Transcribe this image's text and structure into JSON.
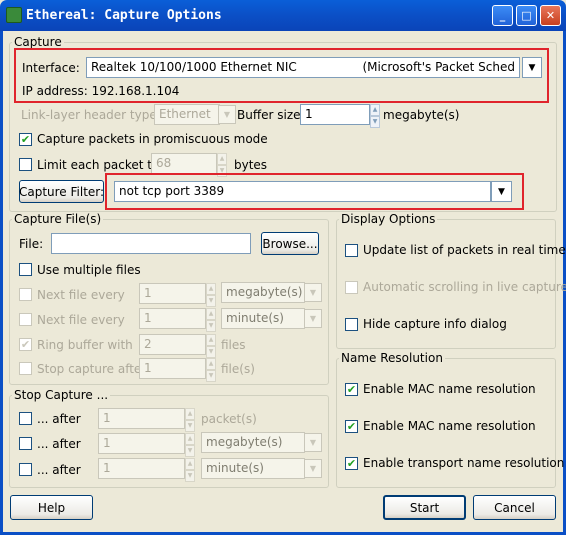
{
  "window": {
    "title": "Ethereal: Capture Options",
    "minimize": "_",
    "maximize": "□",
    "close": "✕"
  },
  "capture": {
    "legend": "Capture",
    "interface_label": "Interface:",
    "interface_value": "Realtek 10/100/1000 Ethernet NIC",
    "interface_suffix": "(Microsoft's Packet Sched",
    "ip_address": "IP address: 192.168.1.104",
    "link_layer_label": "Link-layer header type:",
    "link_layer_value": "Ethernet",
    "buffer_label": "Buffer size:",
    "buffer_value": "1",
    "buffer_unit": "megabyte(s)",
    "promiscuous_label": "Capture packets in promiscuous mode",
    "limit_label": "Limit each packet to",
    "limit_value": "68",
    "limit_unit": "bytes",
    "filter_button": "Capture Filter:",
    "filter_value": "not tcp port 3389"
  },
  "capture_files": {
    "legend": "Capture File(s)",
    "file_label": "File:",
    "file_value": "",
    "browse": "Browse...",
    "multiple_files": "Use multiple files",
    "next_every_1": "Next file every",
    "next_every_1_value": "1",
    "next_every_1_unit": "megabyte(s)",
    "next_every_2": "Next file every",
    "next_every_2_value": "1",
    "next_every_2_unit": "minute(s)",
    "ring_buffer": "Ring buffer with",
    "ring_buffer_value": "2",
    "ring_buffer_unit": "files",
    "stop_after": "Stop capture after",
    "stop_after_value": "1",
    "stop_after_unit": "file(s)"
  },
  "stop_capture": {
    "legend": "Stop Capture ...",
    "row1_label": "... after",
    "row1_value": "1",
    "row1_unit": "packet(s)",
    "row2_label": "... after",
    "row2_value": "1",
    "row2_unit": "megabyte(s)",
    "row3_label": "... after",
    "row3_value": "1",
    "row3_unit": "minute(s)"
  },
  "display_options": {
    "legend": "Display Options",
    "update_list": "Update list of packets in real time",
    "auto_scroll": "Automatic scrolling in live capture",
    "hide_info": "Hide capture info dialog"
  },
  "name_resolution": {
    "legend": "Name Resolution",
    "mac": "Enable MAC name resolution",
    "network": "Enable MAC name resolution",
    "transport": "Enable transport name resolution"
  },
  "buttons": {
    "help": "Help",
    "start": "Start",
    "cancel": "Cancel"
  },
  "colors": {
    "titlebar": "#0a4fc6",
    "dialog": "#ece9d8",
    "highlight": "#e0242c"
  }
}
